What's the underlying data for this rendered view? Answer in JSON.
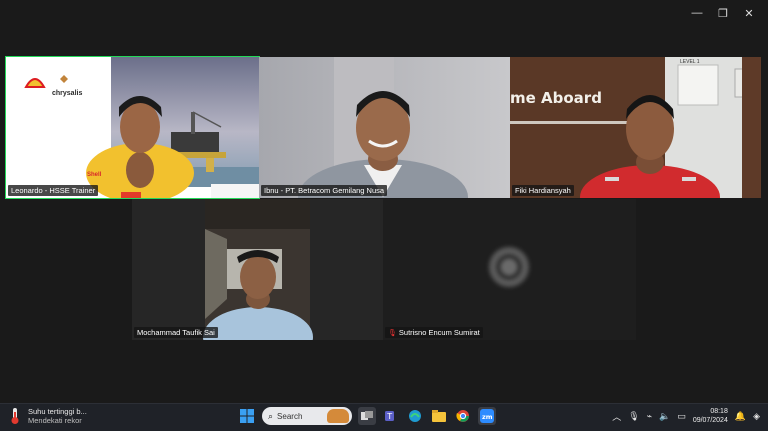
{
  "window": {
    "minimize": "—",
    "restore": "❐",
    "close": "✕"
  },
  "participants": [
    {
      "name": "Leonardo - HSSE Trainer",
      "active": true
    },
    {
      "name": "Ibnu - PT. Betracom Gemilang Nusa"
    },
    {
      "name": "Fiki Hardiansyah"
    },
    {
      "name": "Mochammad Taufik Sai"
    },
    {
      "name": "Sutrisno Encum Sumirat",
      "muted": true
    }
  ],
  "tile1": {
    "logo_text": "Shell",
    "brand": "chrysalis"
  },
  "tile3": {
    "sign_text": "me Aboard",
    "plate": "LEVEL 1"
  },
  "taskbar": {
    "weather_title": "Suhu tertinggi b...",
    "weather_sub": "Mendekati rekor",
    "search_label": "Search",
    "time": "08:18",
    "date": "09/07/2024",
    "accent": "#0078d4"
  }
}
